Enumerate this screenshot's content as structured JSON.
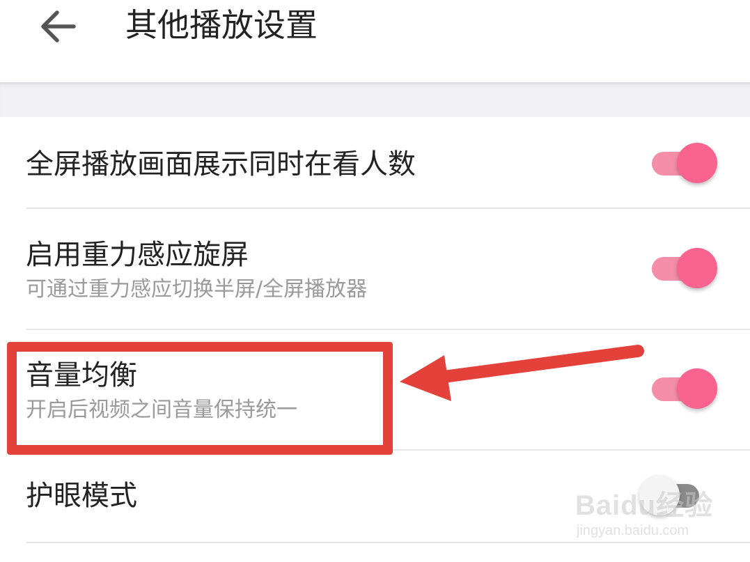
{
  "header": {
    "title": "其他播放设置",
    "back_icon": "arrow-left-icon"
  },
  "settings": [
    {
      "label": "全屏播放画面展示同时在看人数",
      "subtitle": "",
      "enabled": true
    },
    {
      "label": "启用重力感应旋屏",
      "subtitle": "可通过重力感应切换半屏/全屏播放器",
      "enabled": true
    },
    {
      "label": "音量均衡",
      "subtitle": "开启后视频之间音量保持统一",
      "enabled": true
    },
    {
      "label": "护眼模式",
      "subtitle": "",
      "enabled": false
    }
  ],
  "annotation": {
    "highlight_color": "#e5413b",
    "arrow_color": "#e5413b"
  },
  "watermark": {
    "main": "Baidu经验",
    "sub": "jingyan.baidu.com"
  },
  "colors": {
    "toggle_on_thumb": "#fa6290",
    "toggle_on_track": "#f58fa9",
    "toggle_off_track": "#8a8a8a",
    "toggle_off_thumb": "#f4f4f4",
    "section_gap": "#f1f1f3"
  }
}
